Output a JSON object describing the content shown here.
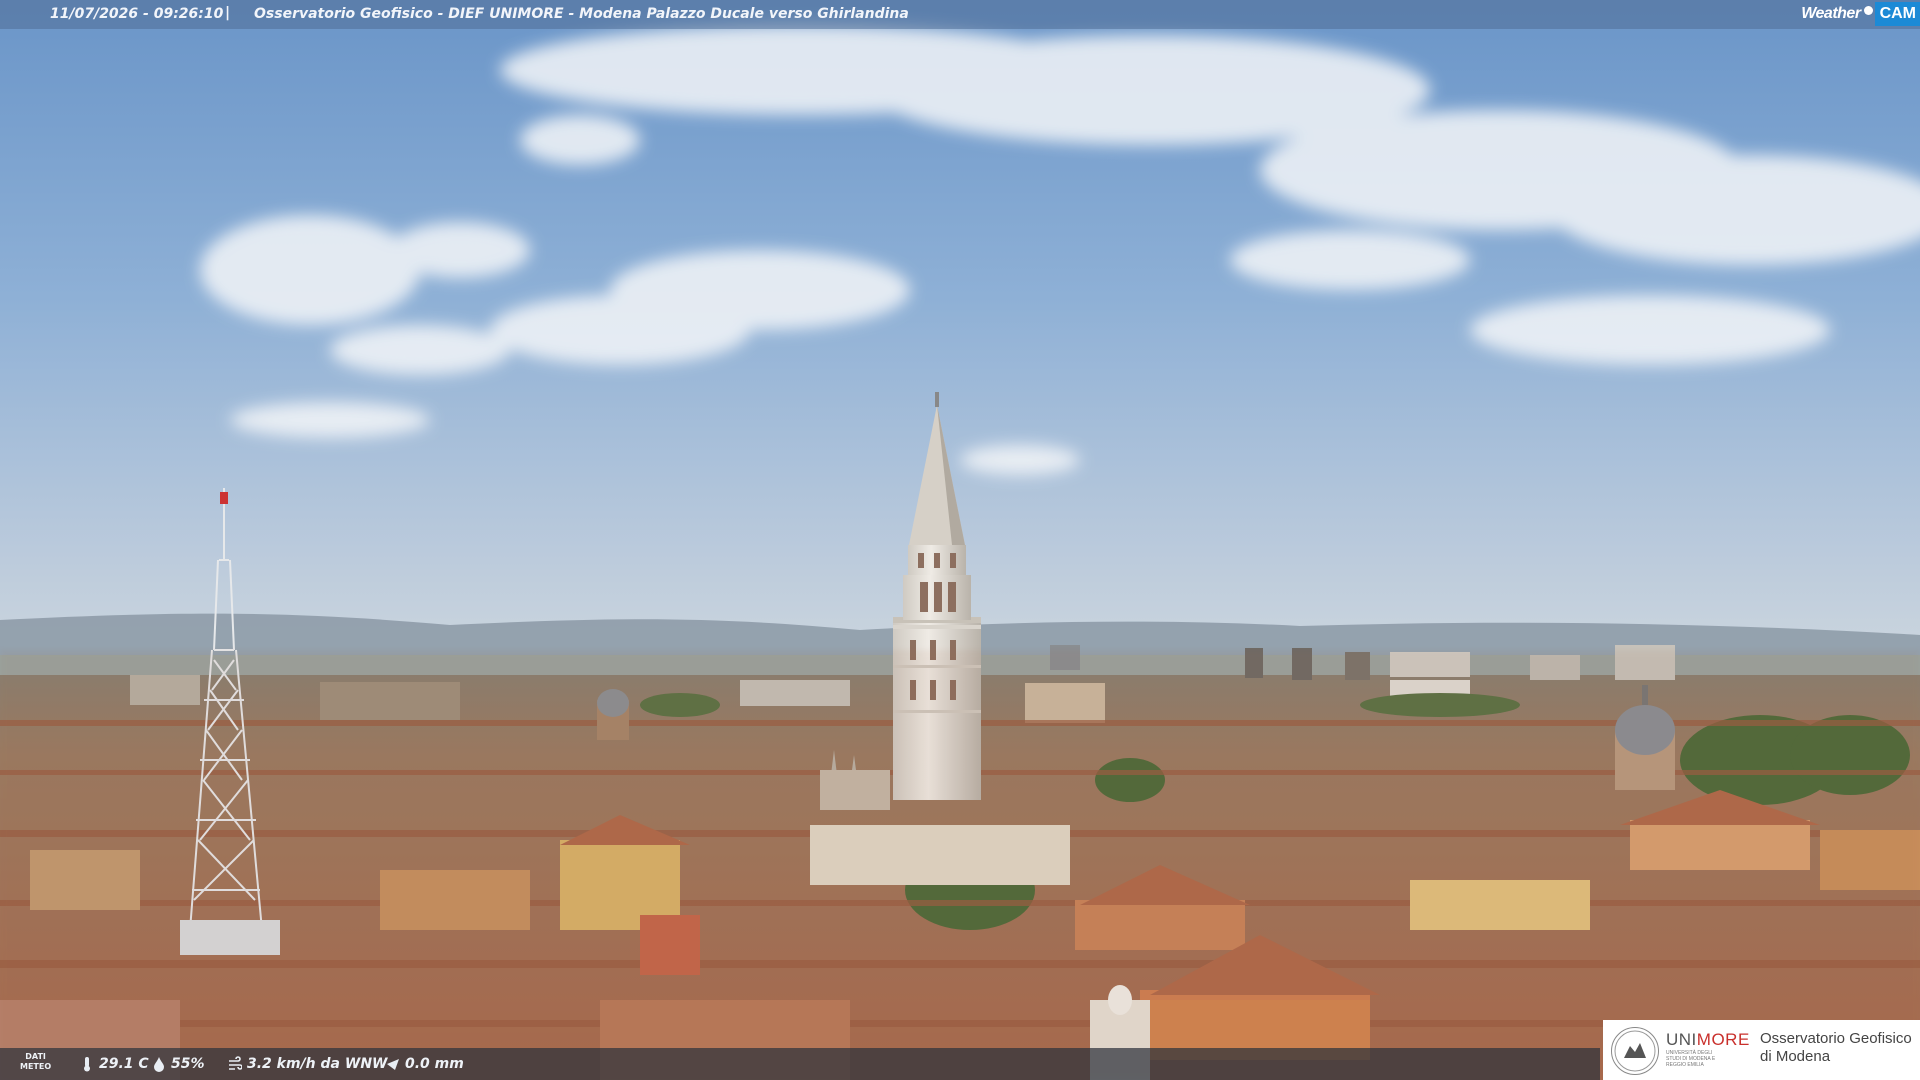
{
  "header": {
    "timestamp": "11/07/2026 - 09:26:10",
    "separator": "|",
    "title": "Osservatorio Geofisico - DIEF UNIMORE - Modena Palazzo Ducale verso Ghirlandina"
  },
  "brand": {
    "weather": "Weather",
    "cam": "CAM"
  },
  "weather_bar": {
    "label_line1": "DATI",
    "label_line2": "METEO",
    "temperature": "29.1 C",
    "humidity": "55%",
    "wind": "3.2 km/h da WNW",
    "rain": "0.0 mm",
    "icons": [
      "thermometer-icon",
      "humidity-icon",
      "wind-icon",
      "rain-icon"
    ]
  },
  "logo": {
    "uni": "UNI",
    "more": "MORE",
    "subtitle": "UNIVERSITÀ DEGLI STUDI DI MODENA E REGGIO EMILIA",
    "observatory_line1": "Osservatorio Geofisico",
    "observatory_line2": "di Modena"
  },
  "colors": {
    "sky_top": "#6f98c9",
    "sky_horizon": "#c7d4de",
    "roofs": "#a8735a",
    "tower": "#e7e3dd",
    "accent_red": "#c9302c",
    "cam_blue": "#1c8ad6"
  }
}
